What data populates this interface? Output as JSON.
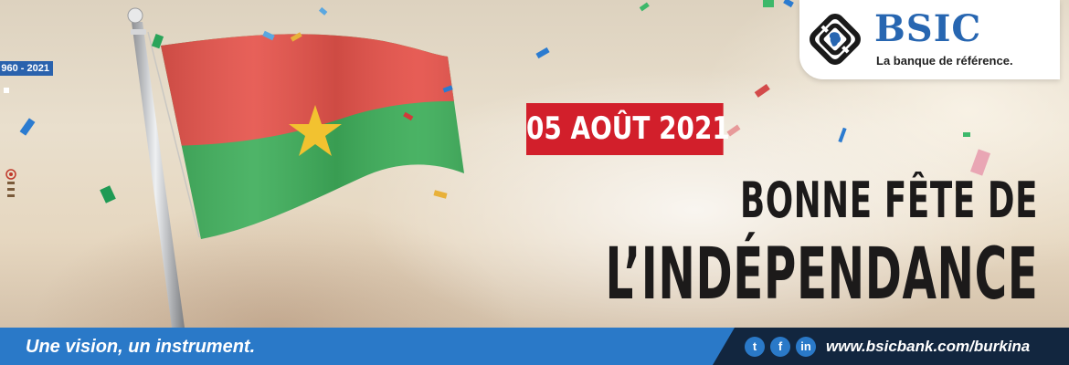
{
  "badge": {
    "years": "960 - 2021"
  },
  "brand": {
    "name": "BSIC",
    "tagline": "La banque de référence."
  },
  "event": {
    "date": "05 AOÛT 2021",
    "headline_line1": "BONNE FÊTE DE",
    "headline_line2": "L’INDÉPENDANCE"
  },
  "footer": {
    "slogan": "Une vision, un instrument.",
    "website": "www.bsicbank.com/burkina",
    "social": [
      {
        "icon": "twitter-icon",
        "glyph": "t"
      },
      {
        "icon": "facebook-icon",
        "glyph": "f"
      },
      {
        "icon": "linkedin-icon",
        "glyph": "in"
      }
    ]
  },
  "colors": {
    "flag_red": "#e5534b",
    "flag_green": "#3fae5b",
    "star": "#f2c230",
    "brand_blue": "#2766b1",
    "date_red": "#d21f2b",
    "footer_blue": "#2a79c8",
    "footer_navy": "#12263f"
  }
}
